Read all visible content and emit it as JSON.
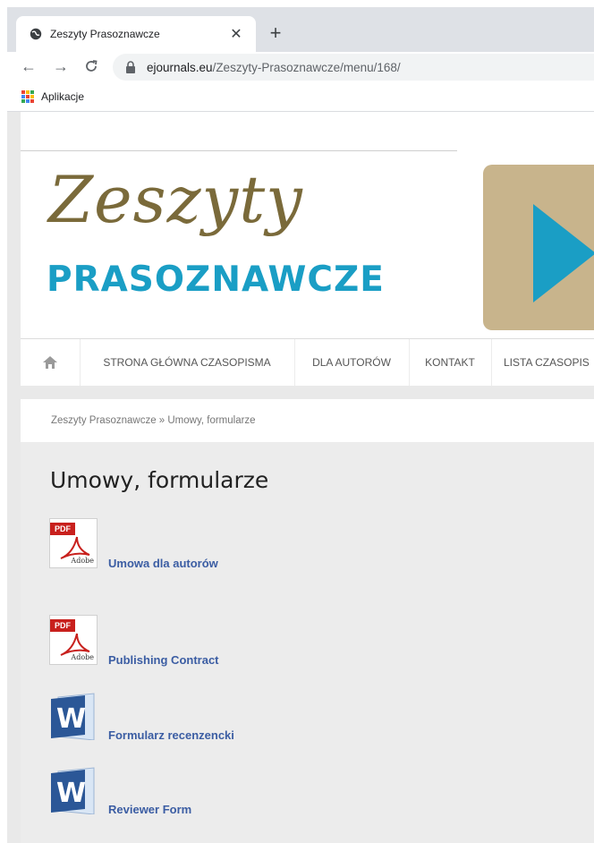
{
  "browser": {
    "tab_title": "Zeszyty Prasoznawcze",
    "url_host": "ejournals.eu",
    "url_path": "/Zeszyty-Prasoznawcze/menu/168/",
    "bookmarks_label": "Aplikacje"
  },
  "header": {
    "logo_line1": "Zeszyty",
    "logo_line2": "PRASOZNAWCZE"
  },
  "menu": {
    "items": [
      "STRONA GŁÓWNA CZASOPISMA",
      "DLA AUTORÓW",
      "KONTAKT",
      "LISTA CZASOPIS"
    ]
  },
  "breadcrumb": "Zeszyty Prasoznawcze » Umowy, formularze",
  "main": {
    "title": "Umowy, formularze",
    "documents": [
      {
        "label": "Umowa dla autorów",
        "type": "pdf"
      },
      {
        "label": "Publishing Contract",
        "type": "pdf"
      },
      {
        "label": "Formularz recenzencki",
        "type": "word"
      },
      {
        "label": "Reviewer Form",
        "type": "word"
      }
    ]
  },
  "colors": {
    "brand_blue": "#1a9ec5",
    "brand_gold": "#7a6a3a",
    "link": "#3b5da3",
    "pdf_red": "#c8201d",
    "word_blue": "#2b5797"
  }
}
